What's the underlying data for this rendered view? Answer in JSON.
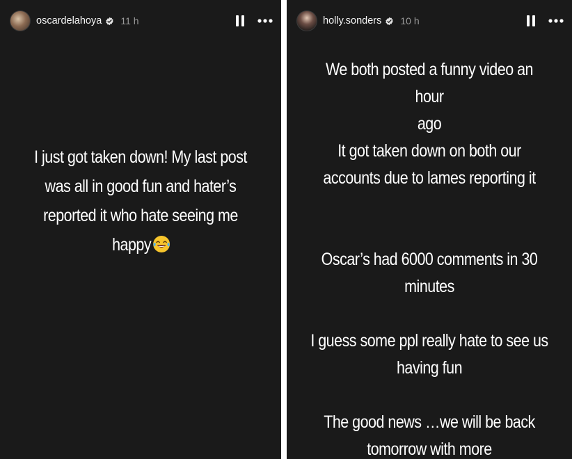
{
  "stories": {
    "left": {
      "username": "oscardelahoya",
      "time": "11 h",
      "lines": [
        "I just got taken down! My last post",
        "was all in good fun and hater’s",
        "reported it who hate seeing me",
        "happy"
      ],
      "emoji": "face-with-tears-of-joy-icon"
    },
    "right": {
      "username": "holly.sonders",
      "time": "10 h",
      "lines": [
        "We both posted a funny video an hour",
        "ago",
        "It got taken down on both our",
        "accounts due to lames reporting it",
        "Oscar’s had 6000 comments in 30",
        "minutes",
        "I guess some ppl really hate to see us",
        "having fun",
        "The good news …we will be back",
        "tomorrow with more"
      ]
    }
  },
  "colors": {
    "story_background": "#1a1a1a",
    "divider": "#ffffff",
    "text": "#ffffff",
    "muted": "#9a9a9a"
  },
  "icons": {
    "verified": "verified-badge-icon",
    "pause": "pause-icon",
    "more": "more-options-icon"
  }
}
